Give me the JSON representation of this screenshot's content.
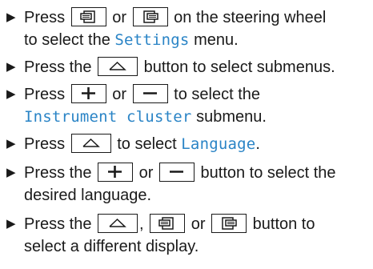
{
  "steps": [
    {
      "lines": [
        {
          "pre": "Press ",
          "mid1": " or ",
          "post": " on the steering wheel"
        },
        {
          "pre": "to select the ",
          "term": "Settings",
          "post": " menu."
        }
      ],
      "keys": [
        "page-back-icon",
        "page-forward-icon"
      ]
    },
    {
      "lines": [
        {
          "pre": "Press the ",
          "post": " button to select submenus."
        }
      ],
      "keys": [
        "home-icon"
      ]
    },
    {
      "lines": [
        {
          "pre": "Press ",
          "mid1": " or ",
          "post": " to select the"
        },
        {
          "term": "Instrument cluster",
          "post": " submenu."
        }
      ],
      "keys": [
        "plus-icon",
        "minus-icon"
      ]
    },
    {
      "lines": [
        {
          "pre": "Press ",
          "mid1": " to select ",
          "term": "Language",
          "post": "."
        }
      ],
      "keys": [
        "home-icon"
      ]
    },
    {
      "lines": [
        {
          "pre": "Press the ",
          "mid1": " or ",
          "post": " button to select the"
        },
        {
          "pre": "desired language."
        }
      ],
      "keys": [
        "plus-icon",
        "minus-icon"
      ]
    },
    {
      "lines": [
        {
          "pre": "Press the ",
          "mid1": ", ",
          "mid2": " or ",
          "post": " button to"
        },
        {
          "pre": "select a different display."
        }
      ],
      "keys": [
        "home-icon",
        "page-back-icon",
        "page-forward-icon"
      ]
    }
  ],
  "bullet": "▶",
  "colors": {
    "term": "#2a84c6",
    "text": "#1a1a1a"
  }
}
